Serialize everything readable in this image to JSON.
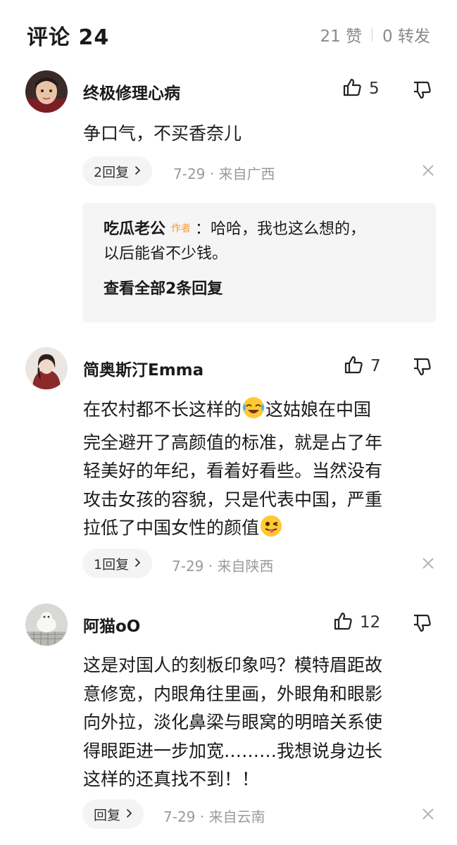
{
  "header": {
    "title": "评论 24",
    "likes": "21 赞",
    "reposts": "0 转发"
  },
  "comments": [
    {
      "username": "终极修理心病",
      "likes": "5",
      "text": "争口气，不买香奈儿",
      "reply_pill": "2回复",
      "meta": "7-29 · 来自广西",
      "replies_preview": {
        "author": "吃瓜老公",
        "badge": "作者",
        "text_line1": "：哈哈，我也这么想的，",
        "text_line2": "以后能省不少钱。",
        "view_all": "查看全部2条回复"
      }
    },
    {
      "username": "简奥斯汀Emma",
      "likes": "7",
      "text_lines": [
        "在农村都不长这样的",
        "这姑娘在中国",
        "完全避开了高颜值的标准，就是占了年",
        "轻美好的年纪，看着好看些。当然没有",
        "攻击女孩的容貌，只是代表中国，严重",
        "拉低了中国女性的颜值"
      ],
      "reply_pill": "1回复",
      "meta": "7-29 · 来自陕西"
    },
    {
      "username": "阿猫oO",
      "likes": "12",
      "text_lines": [
        "这是对国人的刻板印象吗？模特眉距故",
        "意修宽，内眼角往里画，外眼角和眼影",
        "向外拉，淡化鼻梁与眼窝的明暗关系使",
        "得眼距进一步加宽………我想说身边长",
        "这样的还真找不到！！"
      ],
      "reply_pill": "回复",
      "meta": "7-29 · 来自云南"
    }
  ],
  "colors": {
    "author_badge": "#f29b38",
    "meta_gray": "#9a9a9a",
    "pill_bg": "#f4f4f4",
    "reply_box_bg": "#f5f5f5"
  },
  "icons": [
    "thumbs-up-icon",
    "thumbs-down-icon",
    "chevron-right-icon",
    "close-icon",
    "laugh-cry-emoji",
    "wink-tongue-emoji"
  ]
}
